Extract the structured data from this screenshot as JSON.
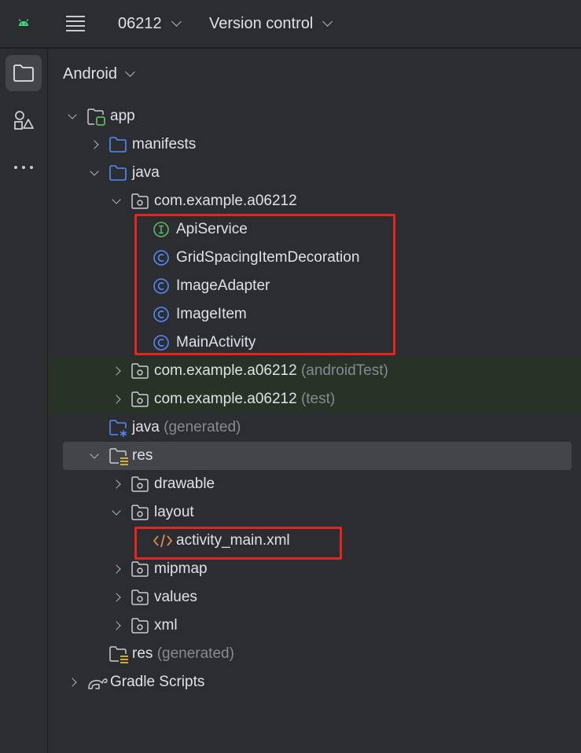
{
  "topbar": {
    "logo_icon": "android-icon",
    "menu_icon": "hamburger-menu-icon",
    "project_name": "06212",
    "vcs_label": "Version control"
  },
  "rail": {
    "items": [
      {
        "icon": "folder-icon",
        "active": true
      },
      {
        "icon": "shapes-icon",
        "active": false
      },
      {
        "icon": "more-icon",
        "active": false
      }
    ]
  },
  "panel": {
    "view_mode": "Android"
  },
  "tree": [
    {
      "label": "app",
      "hint": "",
      "icon": "module-icon",
      "expander": "down",
      "level": 0
    },
    {
      "label": "manifests",
      "hint": "",
      "icon": "folder-icon",
      "expander": "right",
      "level": 1
    },
    {
      "label": "java",
      "hint": "",
      "icon": "folder-icon",
      "expander": "down",
      "level": 1
    },
    {
      "label": "com.example.a06212",
      "hint": "",
      "icon": "package-icon",
      "expander": "down",
      "level": 2
    },
    {
      "label": "ApiService",
      "hint": "",
      "icon": "interface-icon",
      "expander": "none",
      "level": 3
    },
    {
      "label": "GridSpacingItemDecoration",
      "hint": "",
      "icon": "class-icon",
      "expander": "none",
      "level": 3
    },
    {
      "label": "ImageAdapter",
      "hint": "",
      "icon": "class-icon",
      "expander": "none",
      "level": 3
    },
    {
      "label": "ImageItem",
      "hint": "",
      "icon": "class-icon",
      "expander": "none",
      "level": 3
    },
    {
      "label": "MainActivity",
      "hint": "",
      "icon": "class-icon",
      "expander": "none",
      "level": 3
    },
    {
      "label": "com.example.a06212",
      "hint": "(androidTest)",
      "icon": "package-icon",
      "expander": "right",
      "level": 2
    },
    {
      "label": "com.example.a06212",
      "hint": "(test)",
      "icon": "package-icon",
      "expander": "right",
      "level": 2
    },
    {
      "label": "java",
      "hint": "(generated)",
      "icon": "generated-folder-icon",
      "expander": "none",
      "level": 1
    },
    {
      "label": "res",
      "hint": "",
      "icon": "resource-folder-icon",
      "expander": "down",
      "level": 1
    },
    {
      "label": "drawable",
      "hint": "",
      "icon": "package-icon",
      "expander": "right",
      "level": 2
    },
    {
      "label": "layout",
      "hint": "",
      "icon": "package-icon",
      "expander": "down",
      "level": 2
    },
    {
      "label": "activity_main.xml",
      "hint": "",
      "icon": "xml-file-icon",
      "expander": "none",
      "level": 3
    },
    {
      "label": "mipmap",
      "hint": "",
      "icon": "package-icon",
      "expander": "right",
      "level": 2
    },
    {
      "label": "values",
      "hint": "",
      "icon": "package-icon",
      "expander": "right",
      "level": 2
    },
    {
      "label": "xml",
      "hint": "",
      "icon": "package-icon",
      "expander": "right",
      "level": 2
    },
    {
      "label": "res",
      "hint": "(generated)",
      "icon": "resource-folder-icon",
      "expander": "none",
      "level": 1
    },
    {
      "label": "Gradle Scripts",
      "hint": "",
      "icon": "gradle-icon",
      "expander": "right",
      "level": 0
    }
  ],
  "colors": {
    "background": "#2b2d30",
    "selection": "#43454a",
    "test_source_tint": "#283227",
    "folder_blue": "#548af7",
    "interface_green": "#5fb865",
    "class_blue": "#548af7",
    "xml_orange": "#e08855",
    "highlight_red": "#e3261e",
    "hint_gray": "#868a91"
  }
}
